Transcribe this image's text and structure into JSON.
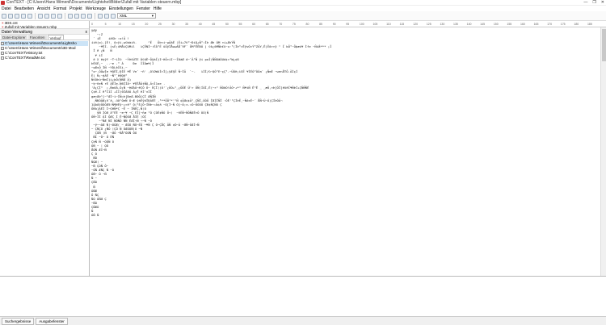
{
  "window": {
    "title": "ConTEXT - [C:\\Users\\Hans Wimenil\\Documents\\Lightshot\\Bilder\\Zufall mit Variablen steuern.mbp]",
    "controls": [
      "—",
      "❐",
      "✕"
    ]
  },
  "menu": [
    "Datei",
    "Bearbeiten",
    "Ansicht",
    "Format",
    "Projekt",
    "Werkzeuge",
    "Einstellungen",
    "Fenster",
    "Hilfe"
  ],
  "toolbar": {
    "highlighter_value": "XML"
  },
  "left_panel": {
    "header": "Datei-Verwaltung",
    "close": "x",
    "tabs": [
      "Datei-Explorer",
      "Favoriten",
      "Verlauf"
    ],
    "items": [
      "C:\\Users\\Hans Wimenil\\Documents\\Lightsho",
      "C:\\Users\\Hans Wimenil\\Documents\\3D Mod",
      "C:\\ConTEXT\\History.txt",
      "C:\\ConTEXT\\ReadMe.txt"
    ]
  },
  "doc_tabs": [
    "3DS.cnt",
    "Zufall mit Variablen steuern.mbp"
  ],
  "ruler": [
    "0",
    "5",
    "10",
    "15",
    "20",
    "25",
    "30",
    "35",
    "40",
    "45",
    "50",
    "55",
    "60",
    "65",
    "70",
    "75",
    "80",
    "85",
    "90",
    "95",
    "100",
    "105",
    "110",
    "115",
    "120",
    "125",
    "130",
    "135",
    "140",
    "145",
    "150",
    "155",
    "160",
    "165",
    "170",
    "175",
    "180",
    "185"
  ],
  "editor_lines": [
    "ÿØÿ",
    "   ~:Z",
    " ` iÉ    iäSÞ :o!Ã !",
    "íi®(o)-[È!¸ ð»ÿi-w©bàiñ.      ^Ë   ÕÞ»i~µÃãÊ ¦Ëi+7ñ°~ÐíQ¿Ñ°:ÍÞ ØÞ ÓM ¤i+ÆhÝÑ",
    "    ~¥ÉI. ìsË;úMÅiÇUMil   ìÇËNÍ~:ÉÀ°Ë ûÕÿÎÅwwÁÅ`9F` ÕM²ÊÉÐÚ | ©ò¿õMÑÞ£ü~u·°(ÍÞ°»ÊÿvÓ»Ý³ZÃY,Ê)Ëõ>>ÿ \" Ï bÕ°~Õþæú¥ Ìfe ~Ñúå*** ¡Ï",
    " Î ê ¿Ñ   Ñ",
    "  ¥ ìÍ",
    " ë X ë¢ÿY ~T~LÌ©  ~Ÿè©ÚTE Ò©üÈ~ÕÿàÏjI~ëÕ>íI~~ÏôàØ ó~¯Ä°Ñ ÿi poÏ(ÑÑOãÓUó¢»¹W¿¢6",
    "ÞÉXÉ,~  ..~e .° Á     Ðe  ÏÏÂæ¥¦Ï",
    "~oÆvÕ ÌÑ ~YDLèÏSi.~",
    "°o~.ÖÕwÍe ¥ÁÊÍ,ÐÌË ¥Ê Ve` ~ñ' ,OlOWûÍ>Î[¡ÿÆ§Ë Ñ~ÌÃ  `~-   ìÍÍ/ü~QÔ°E~çÇ°-~ÜÓë¡ìSË ¥ÍÉÒ°ÒÒa` ¿ÑmÉ ~wenÅTÕ.ÄÍçÍ",
    "Ë| Ñ¡~áÃÉ ~Ñ°`ÞÑQ@°",
    "Ñ©ÒÞú~ÑmÍ)i¿þÕ(ÑÑÆ Ä)",
    "~k~ñeÑ rÉ ÄÊÍe-Ñ6ÍÍÃ~ ¥ÉÊÅÄtÑÀ,Ä<Ï1oe .",
    "'Ä¿ÇÌ^  ¡,ÑoõÃ,Õ¿Ñ ~èÆÁÃ~ëÇÕ Õ~ ËÇÎ¦(Ú'¨¿ÔÒ+\"_¿ÖÕÉ Ü'> ÕÑ¦ÍÀÍ,É(~¤\" ÑÒòÒ!ÃÓ~+*\" Ñ¥iÑ Ê\"Ê _ _æÖ,<Þ[ÖÎ]ëüëÏ¥ÑÞÍ+ÇÑÑÑÉ",
    "Ç¢é-Ï ê³Ì1Í +ÍÍ(0ÍÀôÄ Ä¿Ê ëÍ'±ÍÍ",
    "gæ<ÆÞ¹[~¹ÆÍ~ì~ÍÑ=Þ[ÐeÆ-ÐÐÕ[ÇÎ ÆÑÍÑ",
    " ¸ÑÐÓÃØ¿ñ`ä,.üÙ^ÔeÑ Ó~Æ ÿáÉÿòÎÐÄÉÉ ,²**ÕÕ¹*'\"Ñ ¢ÃÆ¢¢Ã\"_ÇÑÍ,ÓÒÕ ÎÆÍÎÑÎ ·ÔÉ'¹ÇÍÞË_~Ñó±É~¨ ÅÑ~Û~Á)ÇÍÞÓÄ¬",
    "1&òÁ©ÕÓÓÆ5!Ñ¶ëÉÿ~¿»ë¹ Ó(¹É{Õ~ÍÑÞ~=Ä¢ä ~Ó[Ì~Ñ Ò]~Ä;±.=Ó~ÖÒÓÒ ÇÐ¢ÑÇÑÓ Ç",
    "ÕÑù]ÃÉÍ Ì~GHÑ*Ç ~È ~ ÍÑÉÇ,Ñ¦Ó",
    "   ÿÑ ÍÓÆ À°ÉÈ ~e~¥ ~Ç ÉÍ[~ñø ¹Ó ÇÓÉ¢ÑÓ Õ¬¦  ~ñËÑ~ÑÕÑÆÊ>Ô ÒÓ¦Ñ",
    "ÓÑ~ÍÍ ÃÍ ÕÆÇ Í Ê~ÑÕÒÆ ÅÍË ¦ÓÍ",
    "    ~\"ÑÆ ÑÍ ÑÔÑÕ ÑÑ ÉÆÍ¬Ñ ¬~Ñ ~Ó",
    " ~ÿ~¬ÀÆ Ñ¦¬ÓÔÆ( ~ ÆÔÒ ÑÖ~ËÕ ~¥Ñ Ç Ó~ÇÅÇ ÃÑ ¢Ò~Ä ~ÆÑ~ÔÆÍ¬Ñ",
    "~ ÇÑÇÓ ¿ÑÔ ¦ÇÕ Ñ ÔÆÓÒÑ¦Ó ~Ñ",
    "  ÇÕÑ ¦Ñ  ~ÆÔ ~ÑÅ¹ÒÓÑ ÕÓ",
    " ÑÍ ~Õ~ Ó ÉÑ",
    "ÇÞÑ Ñ ~ÓÕÑ Ò",
    "ÒÑ ~ ¦ ÓÕ",
    "ÅÓÑ ÆÍ~Ñ",
    "Ç Ó",
    " ÑÓ",
    "ÑÓÆ¦ ~",
    "~Ñ ÇÓÑ Õ~",
    "~ÔÑ ÆÑÇ Ñ ~Ò",
    "ÓÑ~ Ô ~Ñ",
    "Ñ ~",
    "ÇÑÓ",
    " Ñ",
    "ÒÑÆ",
    "Õ ÑÇ",
    "ÑÒ ÓÑÆ Ç",
    "~ÑÓ",
    "ÇÑÆÒ",
    "Ñ",
    "ÓÑ Ñ"
  ],
  "statusbar": [
    "Suchergebnisse",
    "Ausgabefenster"
  ]
}
